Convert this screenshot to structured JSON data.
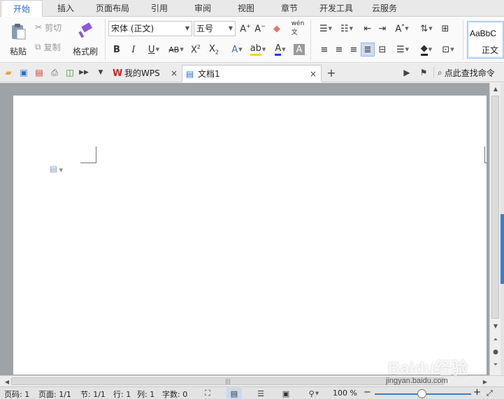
{
  "menu": {
    "tabs": [
      "开始",
      "插入",
      "页面布局",
      "引用",
      "审阅",
      "视图",
      "章节",
      "开发工具",
      "云服务"
    ],
    "active_index": 0
  },
  "ribbon": {
    "clipboard": {
      "paste": "粘贴",
      "cut": "剪切",
      "copy": "复制",
      "format_painter": "格式刷"
    },
    "font": {
      "name": "宋体 (正文)",
      "size": "五号"
    },
    "styles": {
      "preview": "AaBbC",
      "name": "正文"
    },
    "accent_colors": {
      "highlight": "#f5d800",
      "font_color": "#1a3cff",
      "active_tab": "#2b6fd1"
    }
  },
  "quickbar": {
    "tabs": [
      {
        "label": "我的WPS",
        "icon": "wps-logo-icon"
      },
      {
        "label": "文档1",
        "icon": "document-icon"
      }
    ],
    "search_label": "点此查找命令"
  },
  "status": {
    "page_code": "页码: 1",
    "page": "页面: 1/1",
    "section": "节: 1/1",
    "row": "行: 1",
    "col": "列: 1",
    "words": "字数: 0",
    "zoom": "100 %"
  },
  "watermark": {
    "brand": "Baidu经验",
    "url": "jingyan.baidu.com"
  }
}
